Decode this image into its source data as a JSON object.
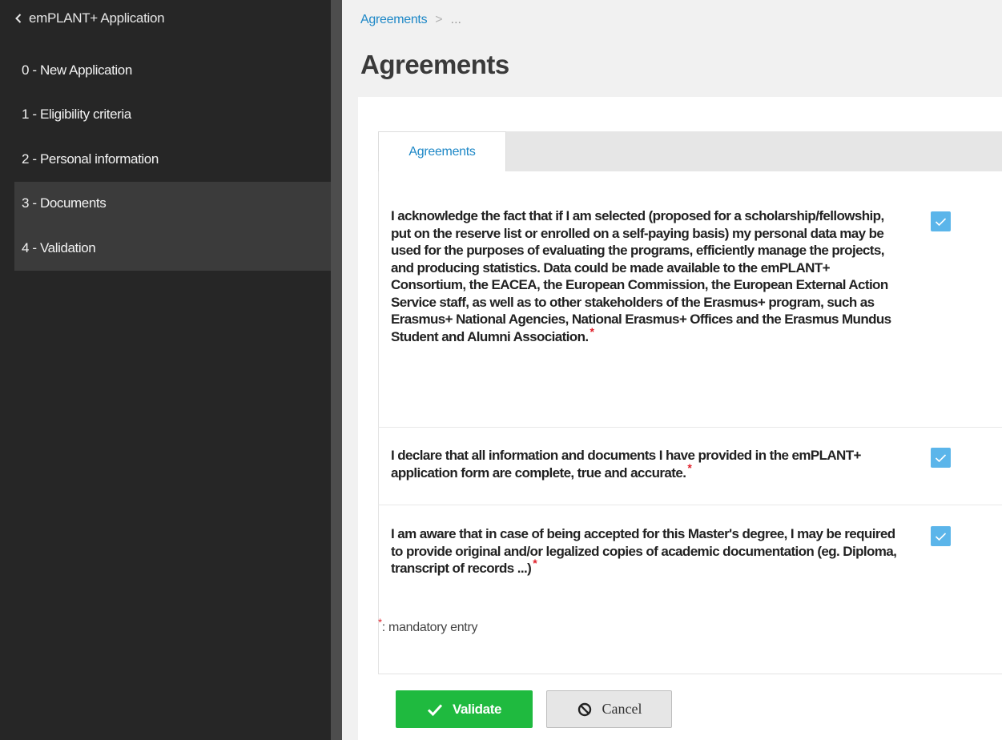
{
  "sidebar": {
    "back_label": "emPLANT+ Application",
    "items": [
      {
        "label": "0 - New Application"
      },
      {
        "label": "1 - Eligibility criteria"
      },
      {
        "label": "2 - Personal information"
      },
      {
        "label": "3 - Documents"
      },
      {
        "label": "4 - Validation"
      }
    ]
  },
  "breadcrumb": {
    "link": "Agreements",
    "separator": ">",
    "more": "..."
  },
  "page_title": "Agreements",
  "tab": {
    "label": "Agreements"
  },
  "agreements": [
    {
      "text": "I acknowledge the fact that if I am selected (proposed for a scholarship/fellowship, put on the reserve list or enrolled on a self-paying basis) my personal data may be used for the purposes of evaluating the programs, efficiently manage the projects, and producing statistics. Data could be made available to the emPLANT+ Consortium, the EACEA, the European Commission, the European External Action Service staff, as well as to other stakeholders of the Erasmus+ program, such as Erasmus+ National Agencies, National Erasmus+ Offices and the Erasmus Mundus Student and Alumni Association.",
      "required_mark": "*",
      "checked": true
    },
    {
      "text": "I declare that all information and documents I have provided in the emPLANT+ application form are complete, true and accurate.",
      "required_mark": "*",
      "checked": true
    },
    {
      "text": "I am aware that in case of being accepted for this Master's degree, I may be required to provide original and/or legalized copies of academic documentation (eg. Diploma, transcript of records ...)",
      "required_mark": "*",
      "checked": true
    }
  ],
  "mandatory_note": {
    "mark": "*",
    "text": ": mandatory entry"
  },
  "buttons": {
    "validate": "Validate",
    "cancel": "Cancel"
  },
  "colors": {
    "sidebar_bg": "#262626",
    "accent_blue": "#1e88c7",
    "checkbox_blue": "#5bb5ea",
    "validate_green": "#1fba3f",
    "required_red": "#e0202a"
  },
  "icons": {
    "back": "chevron-left-icon",
    "checkbox": "check-icon",
    "validate": "check-icon",
    "cancel": "ban-icon"
  }
}
